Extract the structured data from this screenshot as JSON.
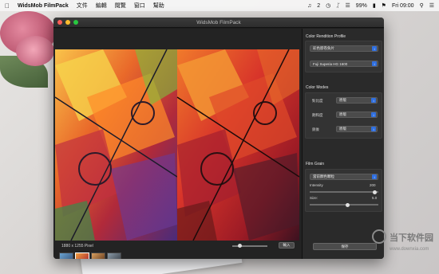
{
  "menubar": {
    "apple_icon": "",
    "app_name": "WidsMob FilmPack",
    "menus": [
      "文件",
      "編輯",
      "閱覽",
      "窗口",
      "幫助"
    ],
    "status": [
      "2",
      "99%",
      "Fri 09:00"
    ]
  },
  "window": {
    "title": "WidsMob FilmPack"
  },
  "viewer": {
    "dimensions": "1880 x 1255 Pixel",
    "import_label": "輸入",
    "zoom_level": 0.15,
    "thumbnail_count": 4
  },
  "panel": {
    "color_rendition": {
      "title": "Color Rendition Profile",
      "profile": "彩色膠卷負片",
      "film": "Fuji Superia HG 1600"
    },
    "color_modes": {
      "title": "Color Modes",
      "rows": [
        {
          "label": "對比度",
          "value": "原版"
        },
        {
          "label": "飽和度",
          "value": "原版"
        },
        {
          "label": "銳後",
          "value": "原版"
        }
      ]
    },
    "film_grain": {
      "title": "Film Grain",
      "grain_type": "當前顏色顆粒",
      "intensity_label": "Intensity",
      "intensity_value": "200",
      "intensity_fraction": 0.95,
      "size_label": "Size:",
      "size_value": "5.0",
      "size_fraction": 0.55
    },
    "save_label": "保存"
  },
  "watermark": {
    "text": "当下软件园",
    "url": "www.downxia.com"
  },
  "colors": {
    "accent": "#2f6fe0",
    "window_bg": "#1e1e1e",
    "panel_bg": "#2a2a2a"
  }
}
